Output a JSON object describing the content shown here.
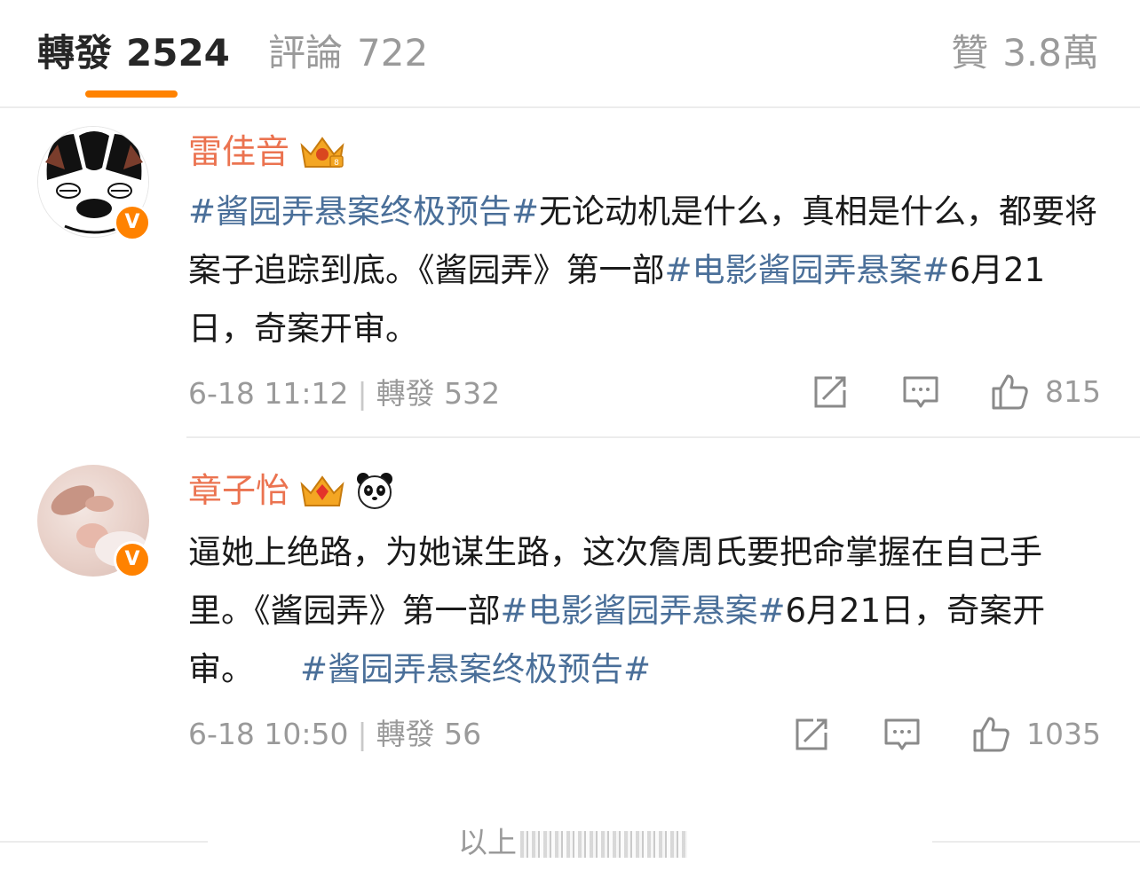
{
  "tabs": {
    "repost": {
      "label": "轉發",
      "count": "2524"
    },
    "comments": {
      "label": "評論",
      "count": "722"
    },
    "likes": {
      "label": "贊",
      "count": "3.8萬"
    },
    "active_color": "#ff8200"
  },
  "posts": [
    {
      "username": "雷佳音",
      "badge_icon": "crown-icon",
      "verified": "V",
      "content": {
        "tag1": "#酱园弄悬案终极预告#",
        "text1": "无论动机是什么，真相是什么，都要将案子追踪到底。《酱园弄》第一部",
        "tag2": "#电影酱园弄悬案#",
        "text2": "6月21日，奇案开审。"
      },
      "time": "6-18 11:12",
      "repost_label": "轉發",
      "repost_count": "532",
      "like_count": "815"
    },
    {
      "username": "章子怡",
      "badge_icon": "crown-icon",
      "extra_icon": "panda-icon",
      "verified": "V",
      "content": {
        "text1": "逼她上绝路，为她谋生路，这次詹周氏要把命掌握在自己手里。《酱园弄》第一部",
        "tag1": "#电影酱园弄悬案#",
        "text2": "6月21日，奇案开审。",
        "tag2": "#酱园弄悬案终极预告#"
      },
      "time": "6-18 10:50",
      "repost_label": "轉發",
      "repost_count": "56",
      "like_count": "1035"
    }
  ],
  "footer": {
    "text": "以上"
  },
  "colors": {
    "username": "#eb7350",
    "hashtag": "#4a6f99",
    "muted": "#9a9a9a",
    "accent": "#ff8200"
  }
}
